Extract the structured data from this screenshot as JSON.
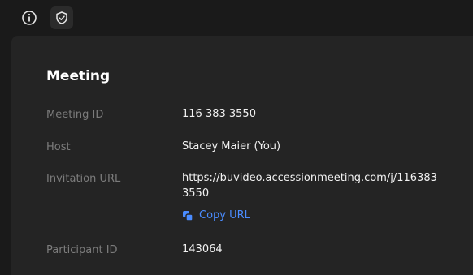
{
  "toolbar": {
    "info_icon": "info-icon",
    "shield_icon": "shield-check-icon"
  },
  "meeting": {
    "title": "Meeting",
    "fields": [
      {
        "label": "Meeting ID",
        "value": "116 383 3550"
      },
      {
        "label": "Host",
        "value": "Stacey Maier (You)"
      },
      {
        "label": "Invitation URL",
        "value": "https://buvideo.accessionmeeting.com/j/116383 3550"
      },
      {
        "label": "Participant ID",
        "value": "143064"
      }
    ],
    "copy_label": "Copy URL"
  },
  "colors": {
    "background": "#1a1a1a",
    "panel": "#242424",
    "label": "#7c7c7c",
    "value": "#f2f2f2",
    "link": "#4a8cff"
  }
}
